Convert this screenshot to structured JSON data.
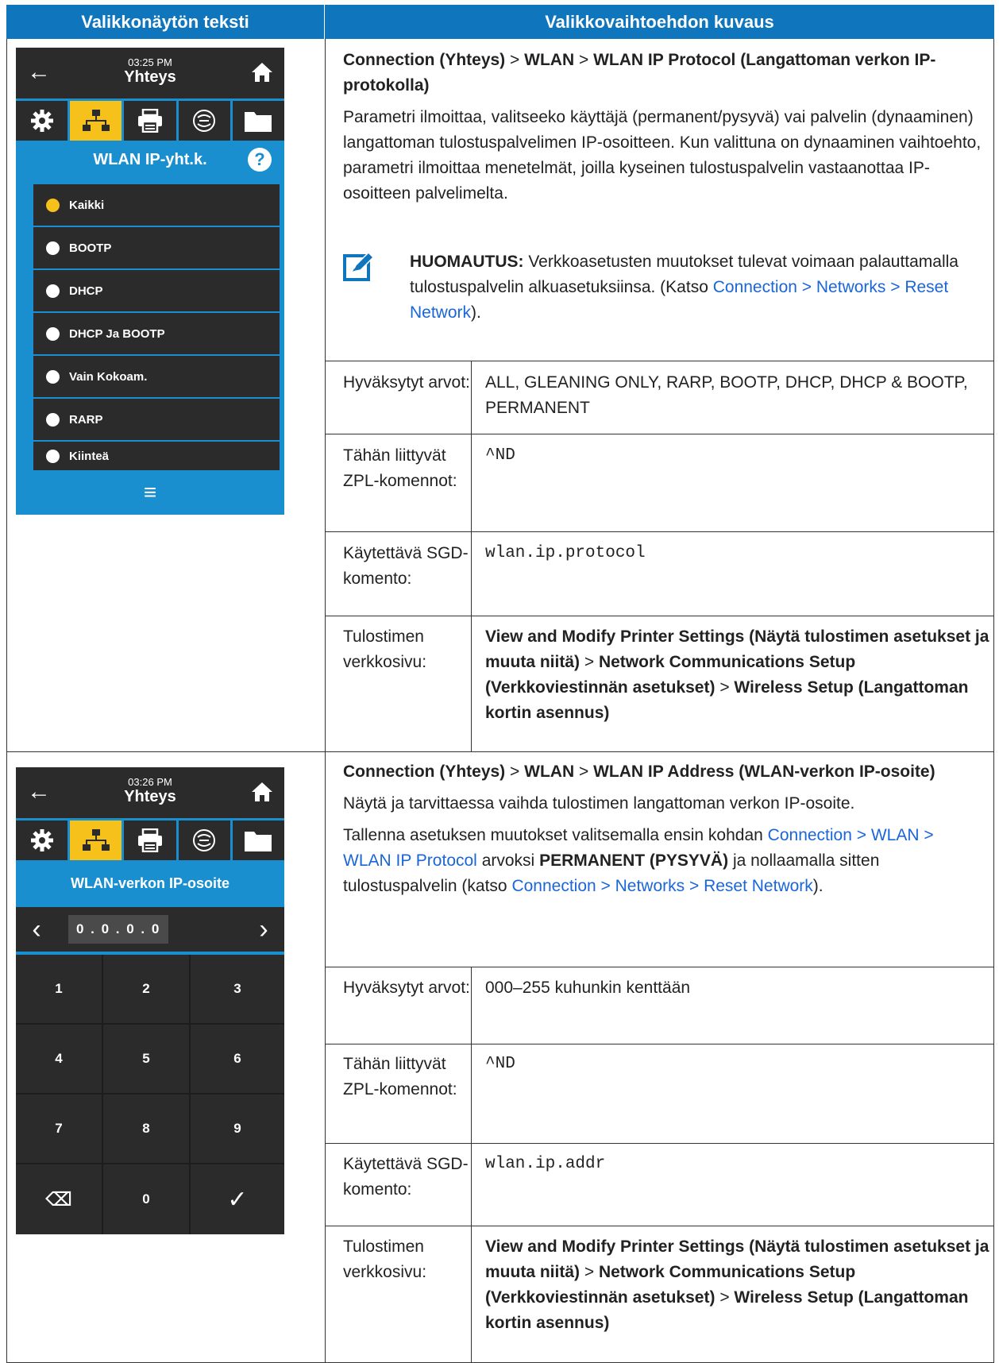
{
  "header": {
    "left": "Valikkonäytön teksti",
    "right": "Valikkovaihtoehdon kuvaus"
  },
  "screen1": {
    "time": "03:25 PM",
    "title": "Yhteys",
    "subtitle": "WLAN IP-yht.k.",
    "help": "?",
    "options": [
      "Kaikki",
      "BOOTP",
      "DHCP",
      "DHCP Ja BOOTP",
      "Vain Kokoam.",
      "RARP",
      "Kiinteä"
    ],
    "selected_index": 0,
    "menu": "≡"
  },
  "screen2": {
    "time": "03:26 PM",
    "title": "Yhteys",
    "subtitle": "WLAN-verkon IP-osoite",
    "ip": "0 . 0 . 0 . 0",
    "keys": [
      "1",
      "2",
      "3",
      "4",
      "5",
      "6",
      "7",
      "8",
      "9",
      "⌫",
      "0",
      "✓"
    ]
  },
  "section1": {
    "path1": "Connection (Yhteys)",
    "sep": ">",
    "path2": "WLAN",
    "path3": "WLAN IP Protocol (Langattoman verkon IP-protokolla)",
    "desc": "Parametri ilmoittaa, valitseeko käyttäjä (permanent/pysyvä) vai palvelin (dynaaminen) langattoman tulostuspalvelimen IP-osoitteen. Kun valittuna on dynaaminen vaihtoehto, parametri ilmoittaa menetelmät, joilla kyseinen tulostuspalvelin vastaanottaa IP-osoitteen palvelimelta.",
    "note_label": "HUOMAUTUS:",
    "note_text": "Verkkoasetusten muutokset tulevat voimaan palauttamalla tulostuspalvelin alkuasetuksiinsa. (Katso",
    "note_link": "Connection > Networks > Reset Network",
    "note_end": ").",
    "rows": [
      {
        "label": "Hyväksytyt arvot:",
        "value": "ALL, GLEANING ONLY, RARP, BOOTP, DHCP, DHCP & BOOTP, PERMANENT"
      },
      {
        "label": "Tähän liittyvät ZPL-komennot:",
        "value": "^ND"
      },
      {
        "label": "Käytettävä SGD-komento:",
        "value": "wlan.ip.protocol"
      }
    ],
    "web_label": "Tulostimen verkkosivu:",
    "web_a": "View and Modify Printer Settings (Näytä tulostimen asetukset ja muuta niitä)",
    "web_b": "Network Communications Setup (Verkkoviestinnän asetukset)",
    "web_c": "Wireless Setup (Langattoman kortin asennus)"
  },
  "section2": {
    "path1": "Connection (Yhteys)",
    "path2": "WLAN",
    "path3": "WLAN IP Address (WLAN-verkon IP-osoite)",
    "desc1": "Näytä ja tarvittaessa vaihda tulostimen langattoman verkon IP-osoite.",
    "desc2a": "Tallenna asetuksen muutokset valitsemalla ensin kohdan",
    "desc2_link": "Connection > WLAN > WLAN IP Protocol",
    "desc2b": "arvoksi",
    "desc2_bold": "PERMANENT (PYSYVÄ)",
    "desc2c": "ja nollaamalla sitten tulostuspalvelin (katso",
    "desc2_link2": "Connection > Networks > Reset Network",
    "desc2d": ").",
    "rows": [
      {
        "label": "Hyväksytyt arvot:",
        "value": "000–255 kuhunkin kenttään"
      },
      {
        "label": "Tähän liittyvät ZPL-komennot:",
        "value": "^ND"
      },
      {
        "label": "Käytettävä SGD-komento:",
        "value": "wlan.ip.addr"
      }
    ],
    "web_label": "Tulostimen verkkosivu:",
    "web_a": "View and Modify Printer Settings (Näytä tulostimen asetukset ja muuta niitä)",
    "web_b": "Network Communications Setup (Verkkoviestinnän asetukset)",
    "web_c": "Wireless Setup (Langattoman kortin asennus)"
  }
}
